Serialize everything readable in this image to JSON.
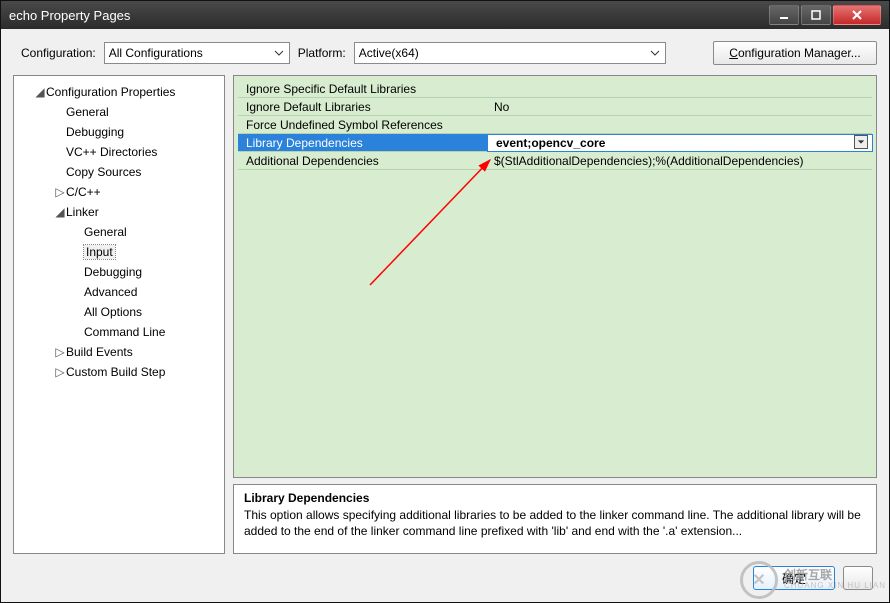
{
  "window": {
    "title": "echo Property Pages"
  },
  "toolbar": {
    "configuration_label": "Configuration:",
    "configuration_value": "All Configurations",
    "platform_label": "Platform:",
    "platform_value": "Active(x64)",
    "config_manager_btn": "Configuration Manager..."
  },
  "tree": {
    "root": "Configuration Properties",
    "items": [
      {
        "label": "General",
        "level": 2
      },
      {
        "label": "Debugging",
        "level": 2
      },
      {
        "label": "VC++ Directories",
        "level": 2
      },
      {
        "label": "Copy Sources",
        "level": 2
      },
      {
        "label": "C/C++",
        "level": 2,
        "twisty": "▷"
      },
      {
        "label": "Linker",
        "level": 2,
        "twisty": "◢"
      },
      {
        "label": "General",
        "level": 3
      },
      {
        "label": "Input",
        "level": 3,
        "selected": true
      },
      {
        "label": "Debugging",
        "level": 3
      },
      {
        "label": "Advanced",
        "level": 3
      },
      {
        "label": "All Options",
        "level": 3
      },
      {
        "label": "Command Line",
        "level": 3
      },
      {
        "label": "Build Events",
        "level": 2,
        "twisty": "▷"
      },
      {
        "label": "Custom Build Step",
        "level": 2,
        "twisty": "▷"
      }
    ]
  },
  "grid": {
    "rows": [
      {
        "k": "Ignore Specific Default Libraries",
        "v": ""
      },
      {
        "k": "Ignore Default Libraries",
        "v": "No"
      },
      {
        "k": "Force Undefined Symbol References",
        "v": ""
      },
      {
        "k": "Library Dependencies",
        "v": "event;opencv_core",
        "selected": true
      },
      {
        "k": "Additional Dependencies",
        "v": "$(StlAdditionalDependencies);%(AdditionalDependencies)"
      }
    ]
  },
  "description": {
    "title": "Library Dependencies",
    "body": "This option allows specifying additional libraries to be  added to the linker command line. The additional library will be added to the end of the linker command line  prefixed with 'lib' and end with the '.a' extension..."
  },
  "footer": {
    "ok": "确定"
  },
  "watermark": {
    "text": "创新互联",
    "sub": "CHUANG XIN HU LIAN"
  }
}
